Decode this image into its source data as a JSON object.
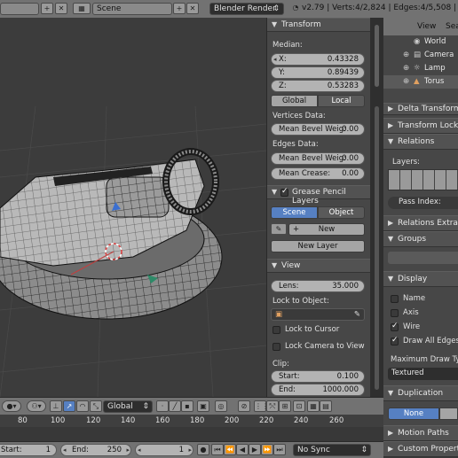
{
  "topbar": {
    "scene": "Scene",
    "render_engine": "Blender Render",
    "stats": "v2.79 | Verts:4/2,824 | Edges:4/5,508 | Fa"
  },
  "outliner": {
    "view": "View",
    "search": "Sea",
    "items": [
      "World",
      "Camera",
      "Lamp",
      "Torus"
    ]
  },
  "npanel": {
    "transform": {
      "title": "Transform",
      "median_label": "Median:",
      "x": {
        "label": "X:",
        "value": "0.43328"
      },
      "y": {
        "label": "Y:",
        "value": "0.89439"
      },
      "z": {
        "label": "Z:",
        "value": "0.53283"
      },
      "global": "Global",
      "local": "Local",
      "vertices_data": "Vertices Data:",
      "mean_bevel_weight_v": {
        "label": "Mean Bevel Weig:",
        "value": "0.00"
      },
      "edges_data": "Edges Data:",
      "mean_bevel_weight_e": {
        "label": "Mean Bevel Weig:",
        "value": "0.00"
      },
      "mean_crease": {
        "label": "Mean Crease:",
        "value": "0.00"
      }
    },
    "grease_pencil": {
      "title": "Grease Pencil Layers",
      "scene": "Scene",
      "object": "Object",
      "new": "New",
      "new_layer": "New Layer"
    },
    "view": {
      "title": "View",
      "lens": {
        "label": "Lens:",
        "value": "35.000"
      },
      "lock_to_object": "Lock to Object:",
      "lock_to_cursor": "Lock to Cursor",
      "lock_camera": "Lock Camera to View",
      "clip": "Clip:",
      "start": {
        "label": "Start:",
        "value": "0.100"
      },
      "end": {
        "label": "End:",
        "value": "1000.000"
      }
    }
  },
  "properties": {
    "delta_transform": "Delta Transform",
    "transform_locks": "Transform Locks",
    "relations": "Relations",
    "layers": "Layers:",
    "pass_index": "Pass Index:",
    "relations_extras": "Relations Extras",
    "groups": "Groups",
    "display": "Display",
    "name": "Name",
    "axis": "Axis",
    "wire": "Wire",
    "draw_all_edges": "Draw All Edges",
    "max_draw_type": "Maximum Draw Type:",
    "textured": "Textured",
    "duplication": "Duplication",
    "none": "None",
    "motion_paths": "Motion Paths",
    "custom_properties": "Custom Properties"
  },
  "vp_header": {
    "orientation": "Global"
  },
  "timeline": {
    "ticks": [
      "80",
      "100",
      "120",
      "140",
      "160",
      "180",
      "200",
      "220",
      "240",
      "260"
    ],
    "start": {
      "label": "Start:",
      "value": "1"
    },
    "end": {
      "label": "End:",
      "value": "250"
    },
    "current": "1",
    "sync": "No Sync"
  },
  "colors": {
    "accent": "#5680c2",
    "panel": "#474747",
    "header": "#727272"
  }
}
